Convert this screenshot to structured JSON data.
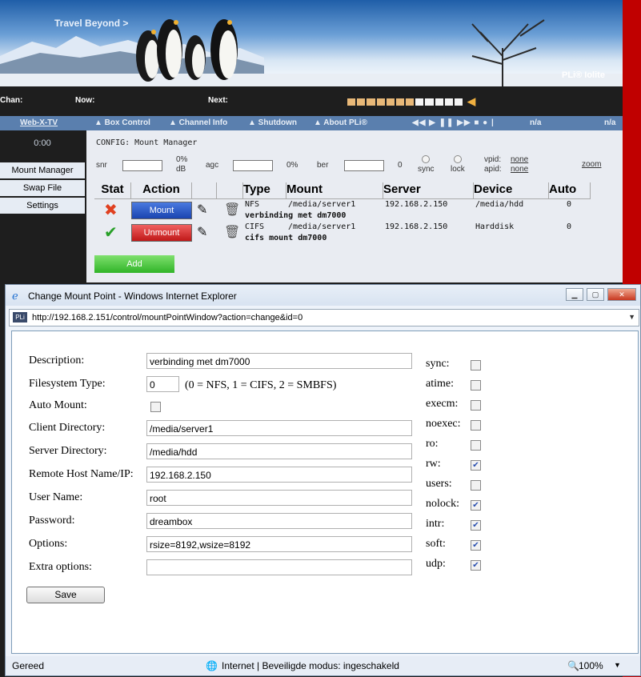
{
  "banner": {
    "slogan": "Travel Beyond >",
    "brand": "PLi® Iolite"
  },
  "infobar": {
    "chan_label": "Chan:",
    "now_label": "Now:",
    "next_label": "Next:"
  },
  "volume": {
    "level_segments": 7,
    "total_segments": 12,
    "color_on": "#e8b878",
    "color_off": "#f4f4f4"
  },
  "nav": {
    "webx": "Web-X-TV",
    "items": [
      "▲ Box Control",
      "▲ Channel Info",
      "▲ Shutdown",
      "▲ About PLi®"
    ],
    "media_controls": "◀◀ ▶ ❚❚ ▶▶ ■ ● |",
    "na1": "n/a",
    "na2": "n/a"
  },
  "sidebar": {
    "clock": "0:00",
    "items": [
      "Mount Manager",
      "Swap File",
      "Settings"
    ]
  },
  "config": {
    "title": "CONFIG: Mount Manager",
    "snr": "snr",
    "snr_val": "0%",
    "db_unit": "dB",
    "agc": "agc",
    "agc_val": "0%",
    "ber": "ber",
    "ber_val": "0",
    "sync": "sync",
    "lock": "lock",
    "vpid_label": "vpid:",
    "vpid_val": "none",
    "apid_label": "apid:",
    "apid_val": "none",
    "zoom": "zoom"
  },
  "mounts": {
    "headers": [
      "Stat",
      "Action",
      "Type",
      "Mount",
      "Server",
      "Device",
      "Auto"
    ],
    "rows": [
      {
        "type": "NFS",
        "mount": "/media/server1",
        "server": "192.168.2.150",
        "device": "/media/hdd",
        "auto": "0",
        "desc": "verbinding met dm7000",
        "action": "Mount",
        "stat": "✖"
      },
      {
        "type": "CIFS",
        "mount": "/media/server1",
        "server": "192.168.2.150",
        "device": "Harddisk",
        "auto": "0",
        "desc": "cifs mount dm7000",
        "action": "Unmount",
        "stat": "✔"
      }
    ],
    "add_label": "Add"
  },
  "ie": {
    "title": "Change Mount Point - Windows Internet Explorer",
    "url": "http://192.168.2.151/control/mountPointWindow?action=change&id=0",
    "favicon": "PLi",
    "form": {
      "description_label": "Description:",
      "description": "verbinding met dm7000",
      "fstype_label": "Filesystem Type:",
      "fstype": "0",
      "fstype_hint": "(0 = NFS, 1 = CIFS, 2 = SMBFS)",
      "automount_label": "Auto Mount:",
      "clientdir_label": "Client Directory:",
      "clientdir": "/media/server1",
      "serverdir_label": "Server Directory:",
      "serverdir": "/media/hdd",
      "host_label": "Remote Host Name/IP:",
      "host": "192.168.2.150",
      "user_label": "User Name:",
      "user": "root",
      "password_label": "Password:",
      "password": "dreambox",
      "options_label": "Options:",
      "options": "rsize=8192,wsize=8192",
      "extra_label": "Extra options:",
      "extra": "",
      "save_label": "Save"
    },
    "options": [
      {
        "label": "sync:",
        "checked": false
      },
      {
        "label": "atime:",
        "checked": false
      },
      {
        "label": "execm:",
        "checked": false
      },
      {
        "label": "noexec:",
        "checked": false
      },
      {
        "label": "ro:",
        "checked": false
      },
      {
        "label": "rw:",
        "checked": true
      },
      {
        "label": "users:",
        "checked": false
      },
      {
        "label": "nolock:",
        "checked": true
      },
      {
        "label": "intr:",
        "checked": true
      },
      {
        "label": "soft:",
        "checked": true
      },
      {
        "label": "udp:",
        "checked": true
      }
    ],
    "status": {
      "left": "Gereed",
      "zone": "Internet | Beveiligde modus: ingeschakeld",
      "zoom": "100%"
    }
  }
}
